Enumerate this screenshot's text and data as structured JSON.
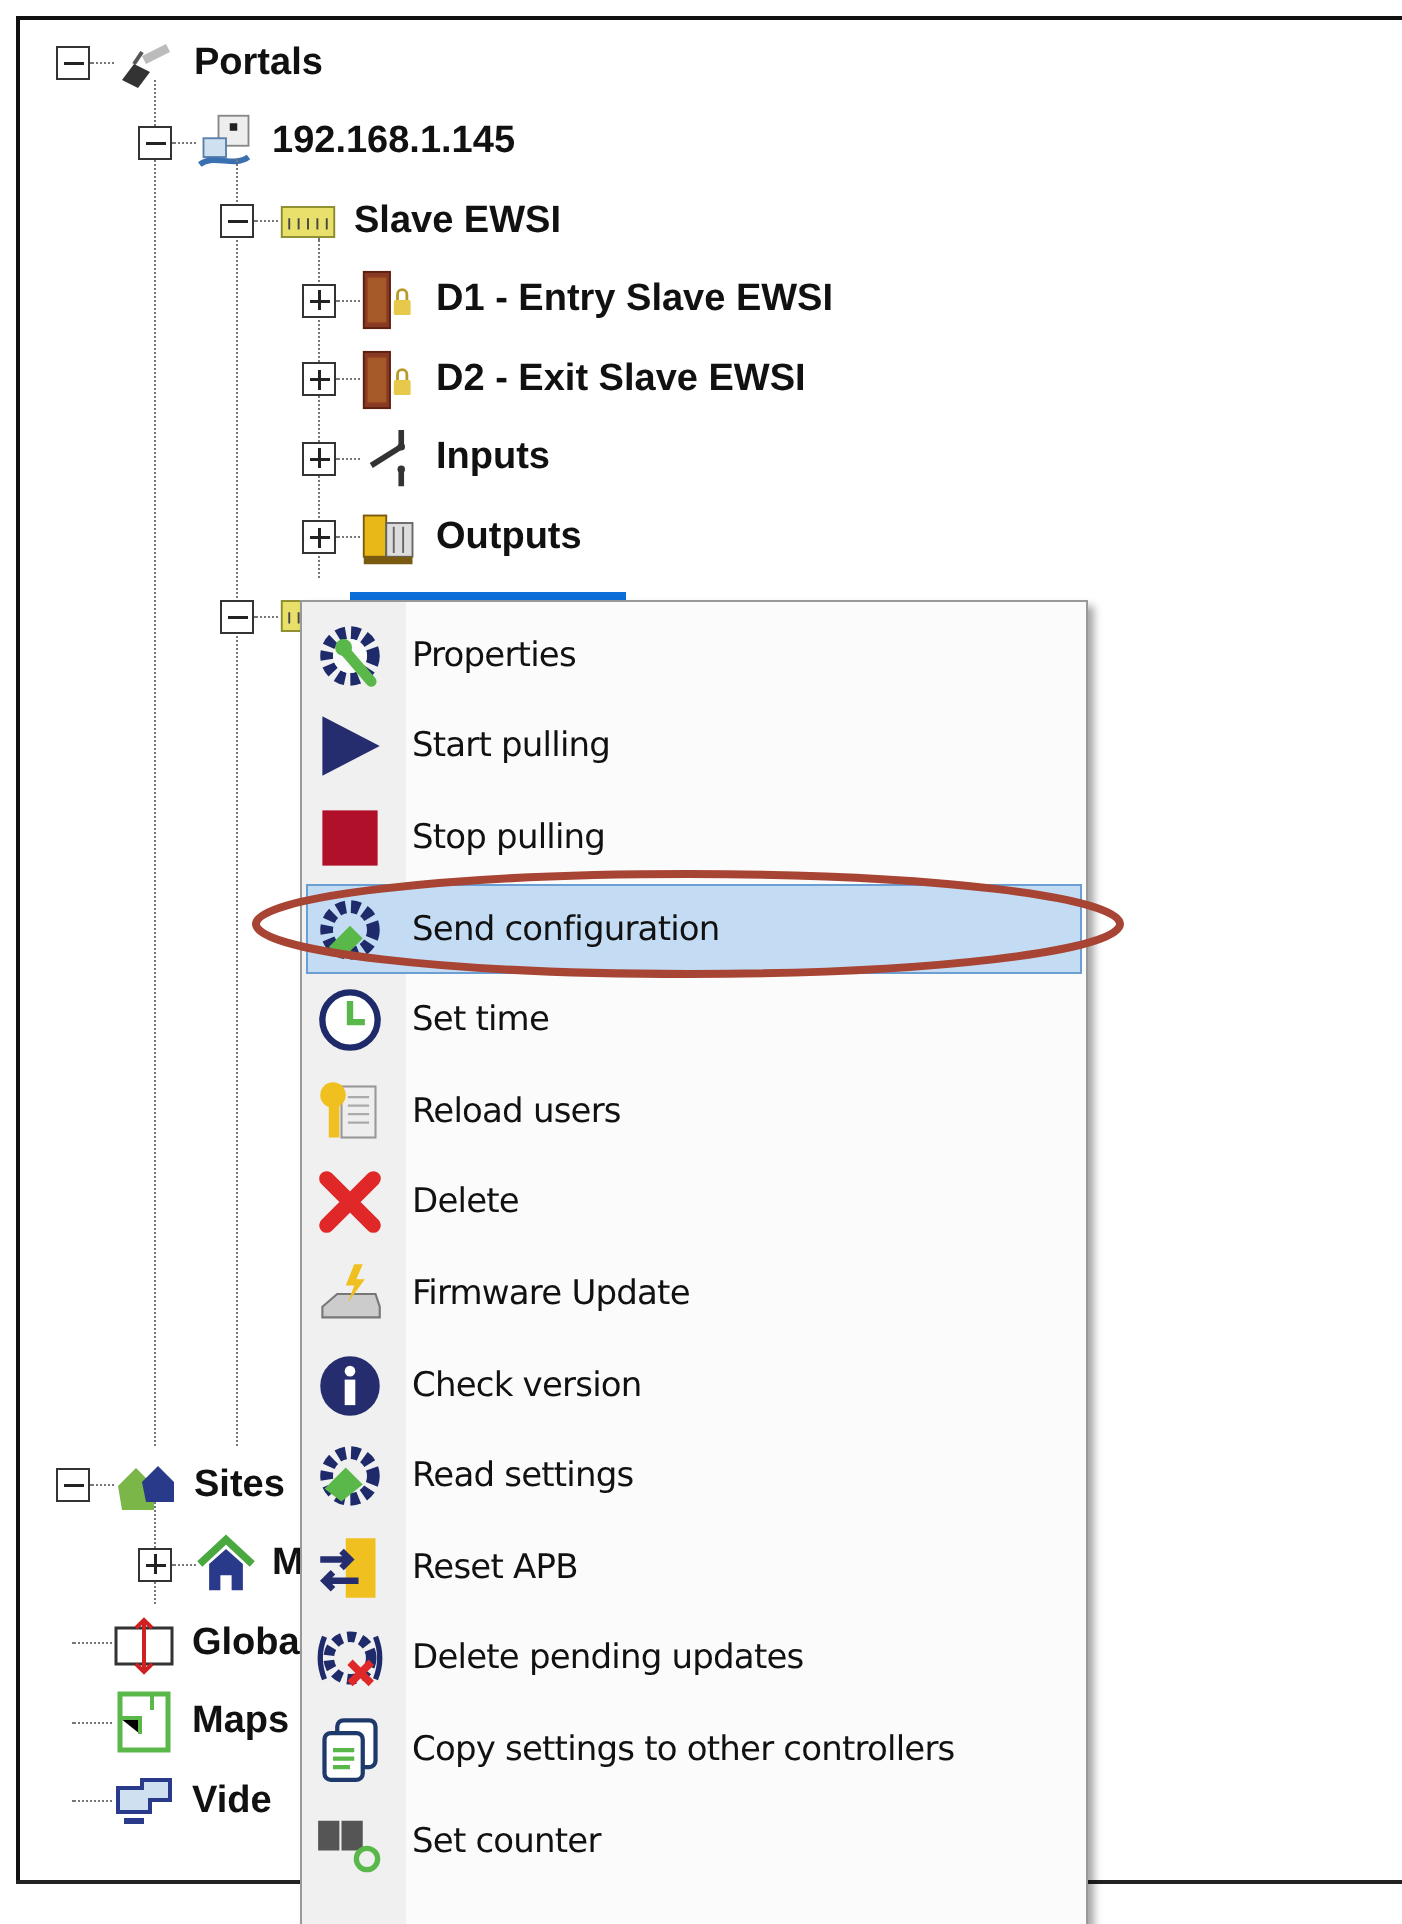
{
  "tree": [
    {
      "label": "Portals",
      "kind": "portal",
      "expanded": true,
      "selected": false,
      "children": [
        {
          "label": "192.168.1.145",
          "kind": "server",
          "expanded": true,
          "selected": false,
          "children": [
            {
              "label": "Slave EWSI",
              "kind": "controller",
              "expanded": true,
              "selected": false,
              "children": [
                {
                  "label": "D1 - Entry Slave EWSI",
                  "kind": "door",
                  "expanded": false,
                  "selected": false
                },
                {
                  "label": "D2 - Exit Slave EWSI",
                  "kind": "door",
                  "expanded": false,
                  "selected": false
                },
                {
                  "label": "Inputs",
                  "kind": "switch",
                  "expanded": false,
                  "selected": false
                },
                {
                  "label": "Outputs",
                  "kind": "relay",
                  "expanded": false,
                  "selected": false
                }
              ]
            },
            {
              "kind": "controller",
              "expanded": true,
              "selected": true
            }
          ]
        }
      ]
    },
    {
      "label": "Sites",
      "kind": "sites",
      "expanded": true,
      "selected": false,
      "children": [
        {
          "label": "M",
          "kind": "house",
          "expanded": false,
          "selected": false
        }
      ]
    },
    {
      "label": "Globa",
      "kind": "global",
      "selected": false
    },
    {
      "label": "Maps",
      "kind": "map",
      "selected": false
    },
    {
      "label": "Vide",
      "kind": "video",
      "selected": false
    }
  ],
  "context_menu": [
    {
      "label": "Properties",
      "kind": "gear-wrench",
      "selected": false,
      "circled": false
    },
    {
      "label": "Start pulling",
      "kind": "play",
      "selected": false,
      "circled": false
    },
    {
      "label": "Stop pulling",
      "kind": "stop",
      "selected": false,
      "circled": false
    },
    {
      "label": "Send configuration",
      "kind": "gear-send",
      "selected": true,
      "circled": true
    },
    {
      "label": "Set time",
      "kind": "clock",
      "selected": false,
      "circled": false
    },
    {
      "label": "Reload users",
      "kind": "key",
      "selected": false,
      "circled": false
    },
    {
      "label": "Delete",
      "kind": "cross",
      "selected": false,
      "circled": false
    },
    {
      "label": "Firmware Update",
      "kind": "firmware",
      "selected": false,
      "circled": false
    },
    {
      "label": "Check version",
      "kind": "info",
      "selected": false,
      "circled": false
    },
    {
      "label": "Read settings",
      "kind": "gear-read",
      "selected": false,
      "circled": false
    },
    {
      "label": "Reset APB",
      "kind": "apb",
      "selected": false,
      "circled": false
    },
    {
      "label": "Delete pending updates",
      "kind": "gear-delete",
      "selected": false,
      "circled": false
    },
    {
      "label": "Copy settings to other controllers",
      "kind": "copy",
      "selected": false,
      "circled": false
    },
    {
      "label": "Set counter",
      "kind": "counter",
      "selected": false,
      "circled": false
    }
  ]
}
